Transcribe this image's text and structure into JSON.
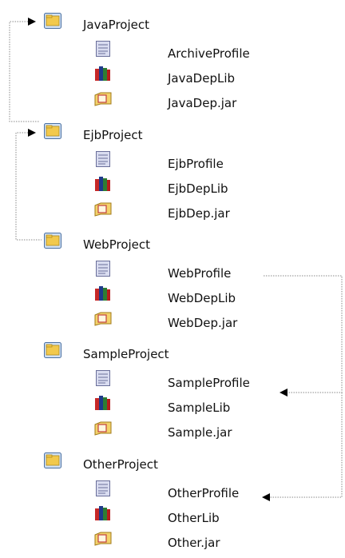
{
  "projects": [
    {
      "name": "JavaProject",
      "items": [
        {
          "type": "profile",
          "label": "ArchiveProfile"
        },
        {
          "type": "lib",
          "label": "JavaDepLib"
        },
        {
          "type": "jar",
          "label": "JavaDep.jar"
        }
      ]
    },
    {
      "name": "EjbProject",
      "items": [
        {
          "type": "profile",
          "label": "EjbProfile"
        },
        {
          "type": "lib",
          "label": "EjbDepLib"
        },
        {
          "type": "jar",
          "label": "EjbDep.jar"
        }
      ]
    },
    {
      "name": "WebProject",
      "items": [
        {
          "type": "profile",
          "label": "WebProfile"
        },
        {
          "type": "lib",
          "label": "WebDepLib"
        },
        {
          "type": "jar",
          "label": "WebDep.jar"
        }
      ]
    },
    {
      "name": "SampleProject",
      "items": [
        {
          "type": "profile",
          "label": "SampleProfile"
        },
        {
          "type": "lib",
          "label": "SampleLib"
        },
        {
          "type": "jar",
          "label": "Sample.jar"
        }
      ]
    },
    {
      "name": "OtherProject",
      "items": [
        {
          "type": "profile",
          "label": "OtherProfile"
        },
        {
          "type": "lib",
          "label": "OtherLib"
        },
        {
          "type": "jar",
          "label": "Other.jar"
        }
      ]
    }
  ],
  "connectors": [
    {
      "from": "JavaProject",
      "to": "EjbProject",
      "style": "dotted",
      "arrow": "end"
    },
    {
      "from": "EjbProject",
      "to": "WebProject",
      "style": "dotted",
      "arrow": "none"
    },
    {
      "from": "WebProfile",
      "to": "SampleProfile",
      "style": "dotted",
      "arrow": "end"
    },
    {
      "from": "WebProfile",
      "to": "OtherProfile",
      "style": "dotted",
      "arrow": "end"
    }
  ],
  "colors": {
    "line": "#8a8a8a",
    "text": "#111111"
  }
}
